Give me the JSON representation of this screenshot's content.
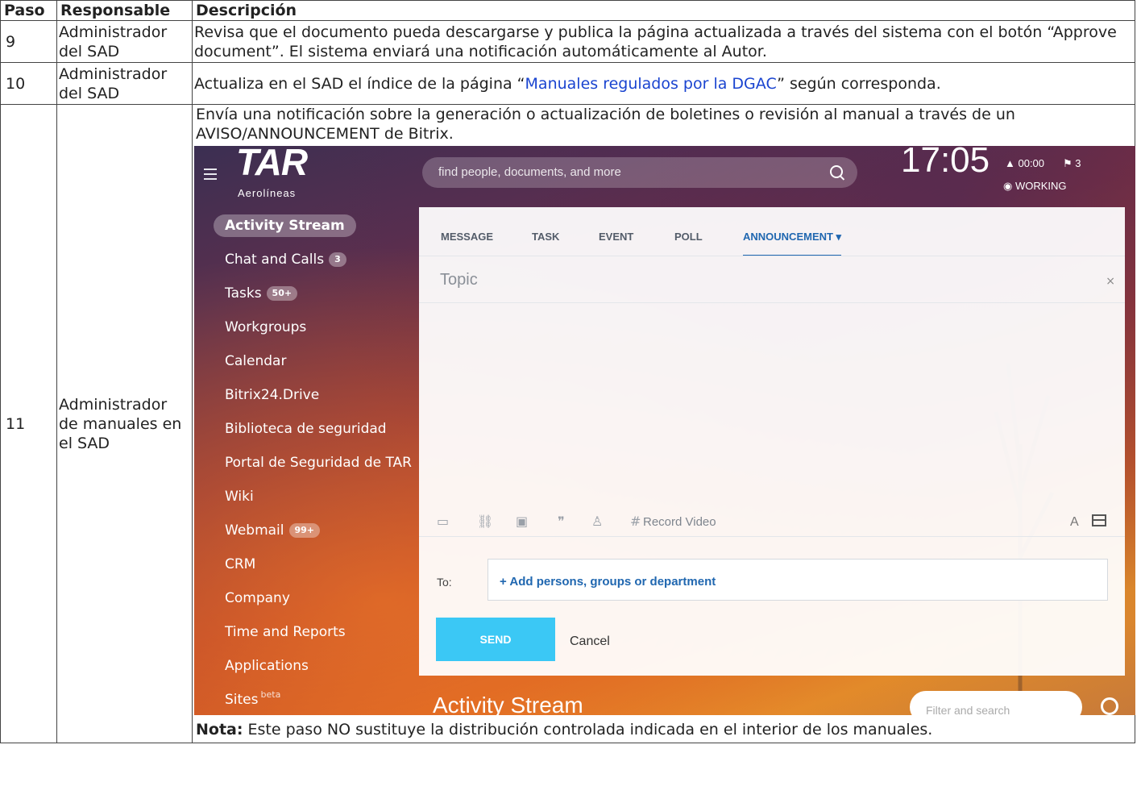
{
  "table": {
    "headers": [
      "Paso",
      "Responsable",
      "Descripción"
    ],
    "row9": {
      "step": "9",
      "resp": "Administrador del SAD",
      "desc": "Revisa que el documento pueda descargarse y publica la página actualizada a través del sistema con el botón “Approve document”. El sistema enviará una notificación automáticamente al Autor."
    },
    "row10": {
      "step": "10",
      "resp": "Administrador del SAD",
      "desc_pre": "Actualiza en el SAD el índice de la página “",
      "desc_link": "Manuales regulados por la DGAC",
      "desc_post": "” según corresponda."
    },
    "row11": {
      "step": "11",
      "resp": "Administrador de manuales en el SAD",
      "desc": "Envía una notificación sobre la generación o actualización de boletines o revisión al manual a través de un AVISO/ANNOUNCEMENT de Bitrix.",
      "note_bold": "Nota:",
      "note": " Este paso NO sustituye la distribución controlada indicada en el interior de los manuales."
    }
  },
  "screenshot": {
    "logo": "TAR",
    "logo_sub": "Aerolíneas",
    "search_placeholder": "find people, documents, and more",
    "clock": "17:05",
    "timer": "▲ 00:00",
    "flags": "⚑ 3",
    "status": "◉ WORKING",
    "nav": [
      {
        "label": "Activity Stream",
        "badge": ""
      },
      {
        "label": "Chat and Calls",
        "badge": "3"
      },
      {
        "label": "Tasks",
        "badge": "50+"
      },
      {
        "label": "Workgroups",
        "badge": ""
      },
      {
        "label": "Calendar",
        "badge": ""
      },
      {
        "label": "Bitrix24.Drive",
        "badge": ""
      },
      {
        "label": "Biblioteca de seguridad",
        "badge": ""
      },
      {
        "label": "Portal de Seguridad de TAR",
        "badge": ""
      },
      {
        "label": "Wiki",
        "badge": ""
      },
      {
        "label": "Webmail",
        "badge": "99+"
      },
      {
        "label": "CRM",
        "badge": ""
      },
      {
        "label": "Company",
        "badge": ""
      },
      {
        "label": "Time and Reports",
        "badge": ""
      },
      {
        "label": "Applications",
        "badge": ""
      },
      {
        "label": "Sites",
        "badge": ""
      }
    ],
    "sites_beta": "beta",
    "tabs": [
      "MESSAGE",
      "TASK",
      "EVENT",
      "POLL",
      "ANNOUNCEMENT ▾"
    ],
    "topic_placeholder": "Topic",
    "close": "×",
    "record_video": "Record Video",
    "font_btn": "A",
    "to_label": "To:",
    "add_persons": "+ Add persons, groups or department",
    "send": "SEND",
    "cancel": "Cancel",
    "activity_title": "Activity Stream",
    "filter_placeholder": "Filter and search"
  }
}
